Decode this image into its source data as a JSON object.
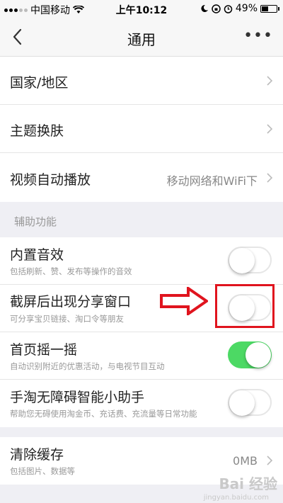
{
  "status_bar": {
    "carrier": "中国移动",
    "time": "上午10:12",
    "battery_level": "49%",
    "battery_fraction": 0.49
  },
  "nav": {
    "title": "通用",
    "more_label": "•••"
  },
  "settings": [
    {
      "label": "国家/地区"
    },
    {
      "label": "主题换肤"
    },
    {
      "label": "视频自动播放",
      "value": "移动网络和WiFi下"
    }
  ],
  "accessibility": {
    "header": "辅助功能",
    "items": [
      {
        "label": "内置音效",
        "sub": "包括刷新、赞、发布等操作的音效",
        "on": false
      },
      {
        "label": "截屏后出现分享窗口",
        "sub": "可分享宝贝链接、淘口令等朋友",
        "on": false
      },
      {
        "label": "首页摇一摇",
        "sub": "自动识别附近的优惠活动，与电视节目互动",
        "on": true
      },
      {
        "label": "手淘无障碍智能小助手",
        "sub": "帮助您无碍使用淘金币、充话费、充流量等日常功能",
        "on": false
      }
    ]
  },
  "cache": {
    "label": "清除缓存",
    "sub": "包括图片、数据等",
    "value": "0MB"
  },
  "colors": {
    "toggle_on": "#4cd964",
    "highlight": "#e0141e"
  },
  "icons": [
    "back-icon",
    "more-icon",
    "chevron-right-icon",
    "wifi-icon",
    "moon-icon",
    "alarm-icon",
    "lock-rotation-icon",
    "battery-icon",
    "red-arrow-icon"
  ],
  "watermark": {
    "text": "Bai 经验",
    "sub": "jingyan.baidu.com"
  }
}
